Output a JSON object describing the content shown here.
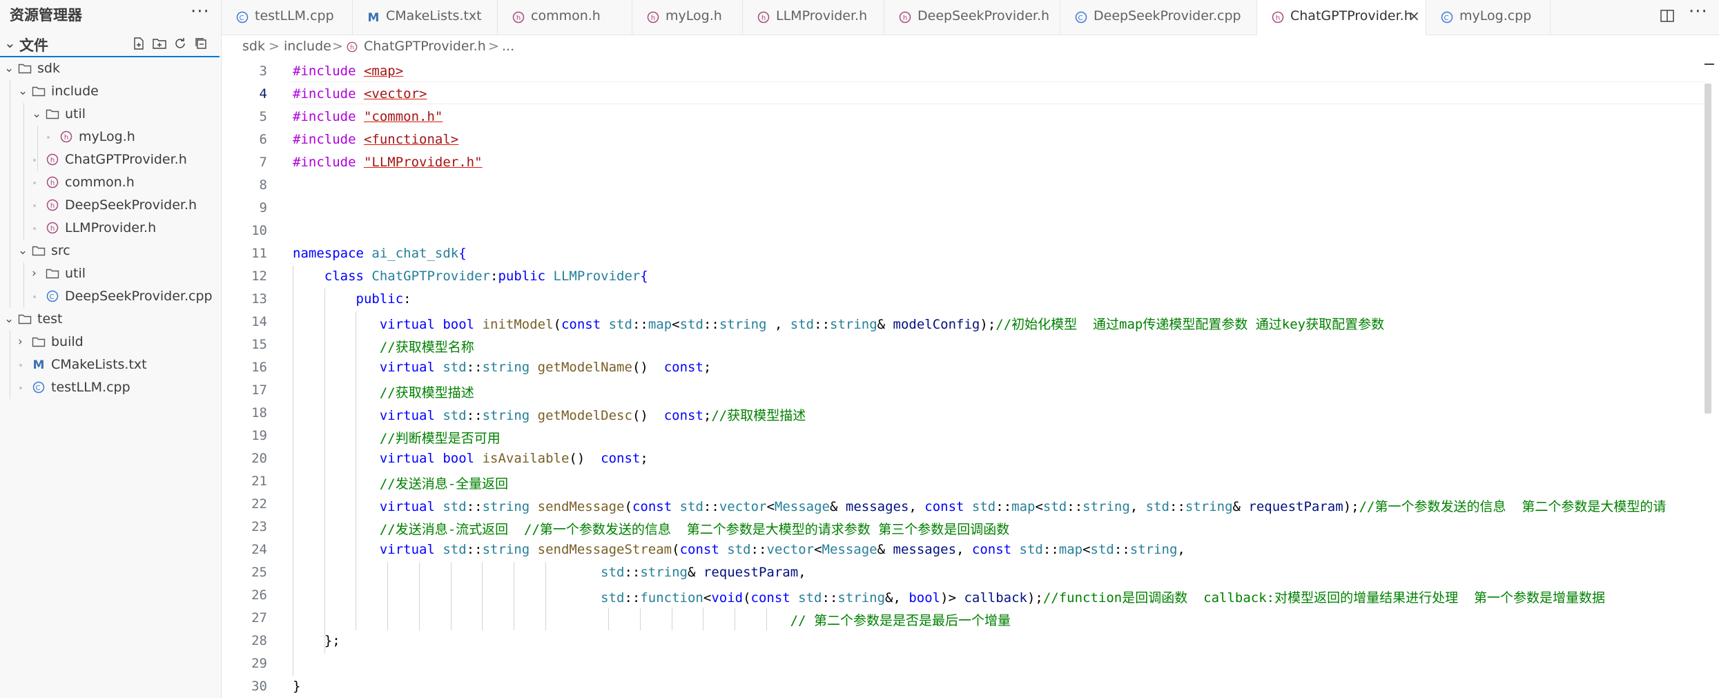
{
  "sidebar": {
    "title": "资源管理器",
    "section_label": "文件",
    "tree": [
      {
        "label": "sdk",
        "kind": "folder"
      },
      {
        "label": "include",
        "kind": "folder"
      },
      {
        "label": "util",
        "kind": "folder"
      },
      {
        "label": "myLog.h",
        "kind": "header"
      },
      {
        "label": "ChatGPTProvider.h",
        "kind": "header"
      },
      {
        "label": "common.h",
        "kind": "header"
      },
      {
        "label": "DeepSeekProvider.h",
        "kind": "header"
      },
      {
        "label": "LLMProvider.h",
        "kind": "header"
      },
      {
        "label": "src",
        "kind": "folder"
      },
      {
        "label": "util",
        "kind": "folder"
      },
      {
        "label": "DeepSeekProvider.cpp",
        "kind": "cpp"
      },
      {
        "label": "test",
        "kind": "folder"
      },
      {
        "label": "build",
        "kind": "folder"
      },
      {
        "label": "CMakeLists.txt",
        "kind": "cmake"
      },
      {
        "label": "testLLM.cpp",
        "kind": "cpp"
      }
    ]
  },
  "tabs": [
    {
      "label": "testLLM.cpp",
      "kind": "cpp"
    },
    {
      "label": "CMakeLists.txt",
      "kind": "cmake"
    },
    {
      "label": "common.h",
      "kind": "header"
    },
    {
      "label": "myLog.h",
      "kind": "header"
    },
    {
      "label": "LLMProvider.h",
      "kind": "header"
    },
    {
      "label": "DeepSeekProvider.h",
      "kind": "header"
    },
    {
      "label": "DeepSeekProvider.cpp",
      "kind": "cpp"
    },
    {
      "label": "ChatGPTProvider.h",
      "kind": "header",
      "active": true,
      "close": "×"
    },
    {
      "label": "myLog.cpp",
      "kind": "cpp"
    }
  ],
  "breadcrumb": {
    "p1": "sdk",
    "p2": "include",
    "p3": "ChatGPTProvider.h",
    "p4": "...",
    "sep": ">"
  },
  "editor": {
    "active_line": 4,
    "lines": [
      {
        "n": "3",
        "tokens": [
          [
            "inc",
            "#include "
          ],
          [
            "str",
            "<map>"
          ]
        ]
      },
      {
        "n": "4",
        "tokens": [
          [
            "inc",
            "#include "
          ],
          [
            "str",
            "<vector>"
          ]
        ]
      },
      {
        "n": "5",
        "tokens": [
          [
            "inc",
            "#include "
          ],
          [
            "str",
            "\"common.h\""
          ]
        ]
      },
      {
        "n": "6",
        "tokens": [
          [
            "inc",
            "#include "
          ],
          [
            "str",
            "<functional>"
          ]
        ]
      },
      {
        "n": "7",
        "tokens": [
          [
            "inc",
            "#include "
          ],
          [
            "str",
            "\"LLMProvider.h\""
          ]
        ]
      },
      {
        "n": "8",
        "tokens": []
      },
      {
        "n": "9",
        "tokens": []
      },
      {
        "n": "10",
        "tokens": []
      },
      {
        "n": "11",
        "tokens": [
          [
            "kw",
            "namespace "
          ],
          [
            "ns",
            "ai_chat_sdk"
          ],
          [
            "kw",
            "{"
          ]
        ]
      },
      {
        "n": "12",
        "tokens": [
          [
            "",
            "    "
          ],
          [
            "kw",
            "class "
          ],
          [
            "ty",
            "ChatGPTProvider"
          ],
          [
            "",
            ":"
          ],
          [
            "kw",
            "public "
          ],
          [
            "ty",
            "LLMProvider"
          ],
          [
            "kw",
            "{"
          ]
        ]
      },
      {
        "n": "13",
        "tokens": [
          [
            "",
            "        "
          ],
          [
            "kw",
            "public"
          ],
          [
            "",
            ":"
          ]
        ]
      },
      {
        "n": "14",
        "tokens": [
          [
            "",
            "           "
          ],
          [
            "kw",
            "virtual bool "
          ],
          [
            "fn",
            "initModel"
          ],
          [
            "",
            "("
          ],
          [
            "kw",
            "const "
          ],
          [
            "ty",
            "std"
          ],
          [
            "",
            "::"
          ],
          [
            "ty",
            "map"
          ],
          [
            "",
            "<"
          ],
          [
            "ty",
            "std"
          ],
          [
            "",
            "::"
          ],
          [
            "ty",
            "string"
          ],
          [
            "",
            " , "
          ],
          [
            "ty",
            "std"
          ],
          [
            "",
            "::"
          ],
          [
            "ty",
            "string"
          ],
          [
            "",
            "& "
          ],
          [
            "pm",
            "modelConfig"
          ],
          [
            "",
            ");"
          ],
          [
            "cm",
            "//初始化模型  通过map传递模型配置参数 通过key获取配置参数"
          ]
        ]
      },
      {
        "n": "15",
        "tokens": [
          [
            "",
            "           "
          ],
          [
            "cm",
            "//获取模型名称"
          ]
        ]
      },
      {
        "n": "16",
        "tokens": [
          [
            "",
            "           "
          ],
          [
            "kw",
            "virtual "
          ],
          [
            "ty",
            "std"
          ],
          [
            "",
            "::"
          ],
          [
            "ty",
            "string "
          ],
          [
            "fn",
            "getModelName"
          ],
          [
            "",
            "()  "
          ],
          [
            "kw",
            "const"
          ],
          [
            "",
            ";"
          ]
        ]
      },
      {
        "n": "17",
        "tokens": [
          [
            "",
            "           "
          ],
          [
            "cm",
            "//获取模型描述"
          ]
        ]
      },
      {
        "n": "18",
        "tokens": [
          [
            "",
            "           "
          ],
          [
            "kw",
            "virtual "
          ],
          [
            "ty",
            "std"
          ],
          [
            "",
            "::"
          ],
          [
            "ty",
            "string "
          ],
          [
            "fn",
            "getModelDesc"
          ],
          [
            "",
            "()  "
          ],
          [
            "kw",
            "const"
          ],
          [
            "",
            ";"
          ],
          [
            "cm",
            "//获取模型描述"
          ]
        ]
      },
      {
        "n": "19",
        "tokens": [
          [
            "",
            "           "
          ],
          [
            "cm",
            "//判断模型是否可用"
          ]
        ]
      },
      {
        "n": "20",
        "tokens": [
          [
            "",
            "           "
          ],
          [
            "kw",
            "virtual bool "
          ],
          [
            "fn",
            "isAvailable"
          ],
          [
            "",
            "()  "
          ],
          [
            "kw",
            "const"
          ],
          [
            "",
            ";"
          ]
        ]
      },
      {
        "n": "21",
        "tokens": [
          [
            "",
            "           "
          ],
          [
            "cm",
            "//发送消息-全量返回"
          ]
        ]
      },
      {
        "n": "22",
        "tokens": [
          [
            "",
            "           "
          ],
          [
            "kw",
            "virtual "
          ],
          [
            "ty",
            "std"
          ],
          [
            "",
            "::"
          ],
          [
            "ty",
            "string "
          ],
          [
            "fn",
            "sendMessage"
          ],
          [
            "",
            "("
          ],
          [
            "kw",
            "const "
          ],
          [
            "ty",
            "std"
          ],
          [
            "",
            "::"
          ],
          [
            "ty",
            "vector"
          ],
          [
            "",
            "<"
          ],
          [
            "ty",
            "Message"
          ],
          [
            "",
            "& "
          ],
          [
            "pm",
            "messages"
          ],
          [
            "",
            ", "
          ],
          [
            "kw",
            "const "
          ],
          [
            "ty",
            "std"
          ],
          [
            "",
            "::"
          ],
          [
            "ty",
            "map"
          ],
          [
            "",
            "<"
          ],
          [
            "ty",
            "std"
          ],
          [
            "",
            "::"
          ],
          [
            "ty",
            "string"
          ],
          [
            "",
            ", "
          ],
          [
            "ty",
            "std"
          ],
          [
            "",
            "::"
          ],
          [
            "ty",
            "string"
          ],
          [
            "",
            "& "
          ],
          [
            "pm",
            "requestParam"
          ],
          [
            "",
            ");"
          ],
          [
            "cm",
            "//第一个参数发送的信息  第二个参数是大模型的请"
          ]
        ]
      },
      {
        "n": "23",
        "tokens": [
          [
            "",
            "           "
          ],
          [
            "cm",
            "//发送消息-流式返回  //第一个参数发送的信息  第二个参数是大模型的请求参数 第三个参数是回调函数"
          ]
        ]
      },
      {
        "n": "24",
        "tokens": [
          [
            "",
            "           "
          ],
          [
            "kw",
            "virtual "
          ],
          [
            "ty",
            "std"
          ],
          [
            "",
            "::"
          ],
          [
            "ty",
            "string "
          ],
          [
            "fn",
            "sendMessageStream"
          ],
          [
            "",
            "("
          ],
          [
            "kw",
            "const "
          ],
          [
            "ty",
            "std"
          ],
          [
            "",
            "::"
          ],
          [
            "ty",
            "vector"
          ],
          [
            "",
            "<"
          ],
          [
            "ty",
            "Message"
          ],
          [
            "",
            "& "
          ],
          [
            "pm",
            "messages"
          ],
          [
            "",
            ", "
          ],
          [
            "kw",
            "const "
          ],
          [
            "ty",
            "std"
          ],
          [
            "",
            "::"
          ],
          [
            "ty",
            "map"
          ],
          [
            "",
            "<"
          ],
          [
            "ty",
            "std"
          ],
          [
            "",
            "::"
          ],
          [
            "ty",
            "string"
          ],
          [
            "",
            ","
          ]
        ]
      },
      {
        "n": "25",
        "tokens": [
          [
            "",
            "                                       "
          ],
          [
            "ty",
            "std"
          ],
          [
            "",
            "::"
          ],
          [
            "ty",
            "string"
          ],
          [
            "",
            "& "
          ],
          [
            "pm",
            "requestParam"
          ],
          [
            "",
            ","
          ]
        ]
      },
      {
        "n": "26",
        "tokens": [
          [
            "",
            "                                       "
          ],
          [
            "ty",
            "std"
          ],
          [
            "",
            "::"
          ],
          [
            "ty",
            "function"
          ],
          [
            "",
            "<"
          ],
          [
            "kw",
            "void"
          ],
          [
            "",
            "("
          ],
          [
            "kw",
            "const "
          ],
          [
            "ty",
            "std"
          ],
          [
            "",
            "::"
          ],
          [
            "ty",
            "string"
          ],
          [
            "",
            "&, "
          ],
          [
            "kw",
            "bool"
          ],
          [
            "",
            ")> "
          ],
          [
            "pm",
            "callback"
          ],
          [
            "",
            ");"
          ],
          [
            "cm",
            "//function是回调函数  callback:对模型返回的增量结果进行处理  第一个参数是增量数据"
          ]
        ]
      },
      {
        "n": "27",
        "tokens": [
          [
            "",
            "                                                               "
          ],
          [
            "cm",
            "// 第二个参数是是否是最后一个增量"
          ]
        ]
      },
      {
        "n": "28",
        "tokens": [
          [
            "",
            "    "
          ],
          [
            "",
            "};"
          ]
        ]
      },
      {
        "n": "29",
        "tokens": []
      },
      {
        "n": "30",
        "tokens": [
          [
            "",
            "}"
          ]
        ]
      }
    ]
  },
  "colors": {
    "accent": "#0078d4",
    "keyword": "#0000ff",
    "include": "#af00db",
    "string": "#a31515",
    "type": "#267f99",
    "function": "#795e26",
    "param": "#001080",
    "comment": "#008000"
  }
}
